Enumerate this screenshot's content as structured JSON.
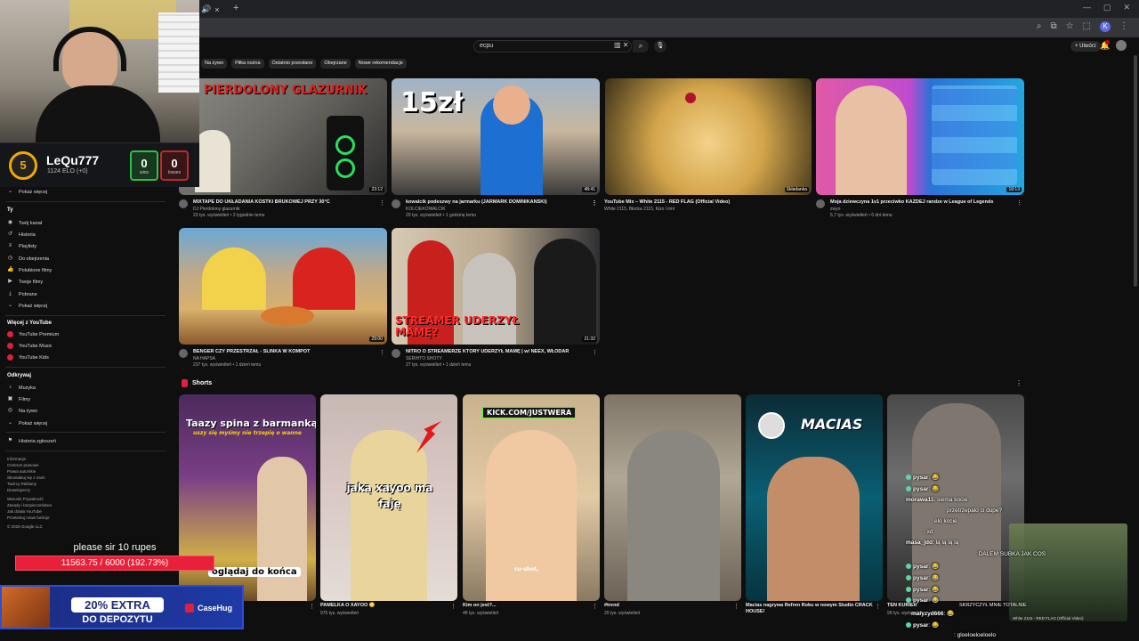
{
  "browser": {
    "tab_close": "×",
    "tab_new": "+",
    "icons": [
      "search-icon",
      "cast-icon",
      "star-icon",
      "extensions-icon",
      "profile-icon",
      "menu-icon"
    ],
    "profile_letter": "K"
  },
  "header": {
    "search_value": "ecpu",
    "upload_label": "+ Utwórz"
  },
  "chips": [
    "Na żywo",
    "Piłka nożna",
    "Ostatnio przesłane",
    "Obejrzane",
    "Nowe rekomendacje"
  ],
  "sidebar": {
    "show_more_1": "Pokaż więcej",
    "you_head": "Ty",
    "you_items": [
      "Twój kanał",
      "Historia",
      "Playlisty",
      "Do obejrzenia",
      "Polubione filmy",
      "Twoje filmy",
      "Pobrane",
      "Pokaż więcej"
    ],
    "more_head": "Więcej z YouTube",
    "more_items": [
      "YouTube Premium",
      "YouTube Music",
      "YouTube Kids"
    ],
    "explore_head": "Odkrywaj",
    "explore_items": [
      "Muzyka",
      "Filmy",
      "Na żywo",
      "Pokaż więcej"
    ],
    "history_item": "Historia zgłoszeń",
    "footer": [
      "Informacje",
      "Centrum prasowe",
      "Prawa autorskie",
      "Skontaktuj się z nami",
      "Twórcy   Reklamy",
      "Deweloperzy",
      "Warunki   Prywatność",
      "Zasady i bezpieczeństwo",
      "Jak działa YouTube",
      "Przetestuj nowe funkcje",
      "© 2026 Google LLC"
    ]
  },
  "videos": [
    {
      "title": "MIXTAPE DO UKŁADANIA KOSTKI BRUKOWEJ PRZY 30°C",
      "channel": "DJ Pierdolony glazurnik",
      "stats": "23 tys. wyświetleń • 2 tygodnie temu",
      "duration": "23:12",
      "thumb_text": "PIERDOLONY GLAZURNIK"
    },
    {
      "title": "kowalcik podeszwy na jarmarku (JARMARK DOMINIKAŃSKI)",
      "channel": "KOLCIEKOWALCIK",
      "stats": "29 tys. wyświetleń • 1 godzinę temu",
      "duration": "48:41",
      "thumb_text": "15zł"
    },
    {
      "title": "YouTube Mix – White 2115 - RED FLAG (Official Video)",
      "channel": "White 2115, Błocka 2115, Kizo i inni",
      "stats": "",
      "duration": "Składanka",
      "thumb_text": ""
    },
    {
      "title": "Moja dziewczyna 1v1 przeciwko KAŻDEJ randze w League of Legends",
      "channel": "zwyo",
      "stats": "5,7 tys. wyświetleń • 6 dni temu",
      "duration": "18:13",
      "thumb_text": ""
    },
    {
      "title": "BENGER CZY PRZESTRZAŁ - ŚLINKA W KOMPOT",
      "channel": "NA HAPSA",
      "stats": "237 tys. wyświetleń • 1 dzień temu",
      "duration": "29:00",
      "thumb_text": ""
    },
    {
      "title": "NITRO O STREAMERZE KTÓRY UDERZYŁ MAMĘ | w/ NEEX, WŁODAR",
      "channel": "SERIHTO SHOTY",
      "stats": "27 tys. wyświetleń • 1 dzień temu",
      "duration": "21:32",
      "thumb_text": "STREAMER UDERZYŁ MAMĘ?"
    }
  ],
  "shorts": {
    "heading": "Shorts",
    "items": [
      {
        "title": "",
        "views": "",
        "top_text": "Taazy spina z barmanką",
        "sub_text": "uszy się myśmy nie trzepię o wanne",
        "bottom_text": "oglądaj do końca"
      },
      {
        "title": "PAMELKA O XAYOO 😳",
        "views": "975 tys. wyświetleń",
        "top_text": "jaką xayoo ma faję",
        "sub_text": "",
        "bottom_text": ""
      },
      {
        "title": "Kim on jest?...",
        "views": "48 tys. wyświetleń",
        "top_text": "KICK.COM/JUSTWERA",
        "sub_text": "",
        "bottom_text": "cu-shot,"
      },
      {
        "title": "#trend",
        "views": "20 tys. wyświetleń",
        "top_text": "",
        "sub_text": "",
        "bottom_text": ""
      },
      {
        "title": "Macias nagrywa Refren Roku w nowym Studio CRACK HOUSE!",
        "views": "",
        "top_text": "MACIAS",
        "sub_text": "",
        "bottom_text": ""
      },
      {
        "title": "TEN KURIER",
        "views": "99 tys. wyświetleń",
        "top_text": "",
        "sub_text": "",
        "bottom_text": ""
      }
    ]
  },
  "overlay": {
    "elo_level": "5",
    "elo_name": "LeQu777",
    "elo_sub": "1124 ELO (+0)",
    "wins": "0",
    "wins_label": "wins",
    "losses": "0",
    "losses_label": "losses",
    "donation_text": "please sir 10 rupes",
    "donation_bar": "11563.75 / 6000 (192.73%)",
    "promo_extra": "20% EXTRA",
    "promo_sub": "DO DEPOZYTU",
    "promo_logo": "CaseHug",
    "mini_title": "White 2115 - RED FLAG (Official Video)"
  },
  "chat": [
    {
      "user": "pysar",
      "msg": ": 😂"
    },
    {
      "user": "pysar",
      "msg": ": 😂"
    },
    {
      "user": "morawa11",
      "msg": ": siema kocie"
    },
    {
      "user": "",
      "msg": "przetrzepalo ci dupe?"
    },
    {
      "user": "",
      "msg": "elo kocie"
    },
    {
      "user": "",
      "msg": ": xd"
    },
    {
      "user": "masa_jdd",
      "msg": ": lą lą lą lą"
    },
    {
      "user": "",
      "msg": ": DALEM SUBKA JAK COS"
    },
    {
      "user": "pysar",
      "msg": ": 😂"
    },
    {
      "user": "pysar",
      "msg": ": 😂"
    },
    {
      "user": "pysar",
      "msg": ": 😂"
    },
    {
      "user": "pysar",
      "msg": ": 😂"
    },
    {
      "user": "",
      "msg": "SKRZYCZYŁ MNIE TOTALNIE"
    },
    {
      "user": "malyzyd666",
      "msg": ": 😂"
    },
    {
      "user": "pysar",
      "msg": ": 😂"
    },
    {
      "user": "",
      "msg": ": gloeloeloeloelo"
    }
  ]
}
